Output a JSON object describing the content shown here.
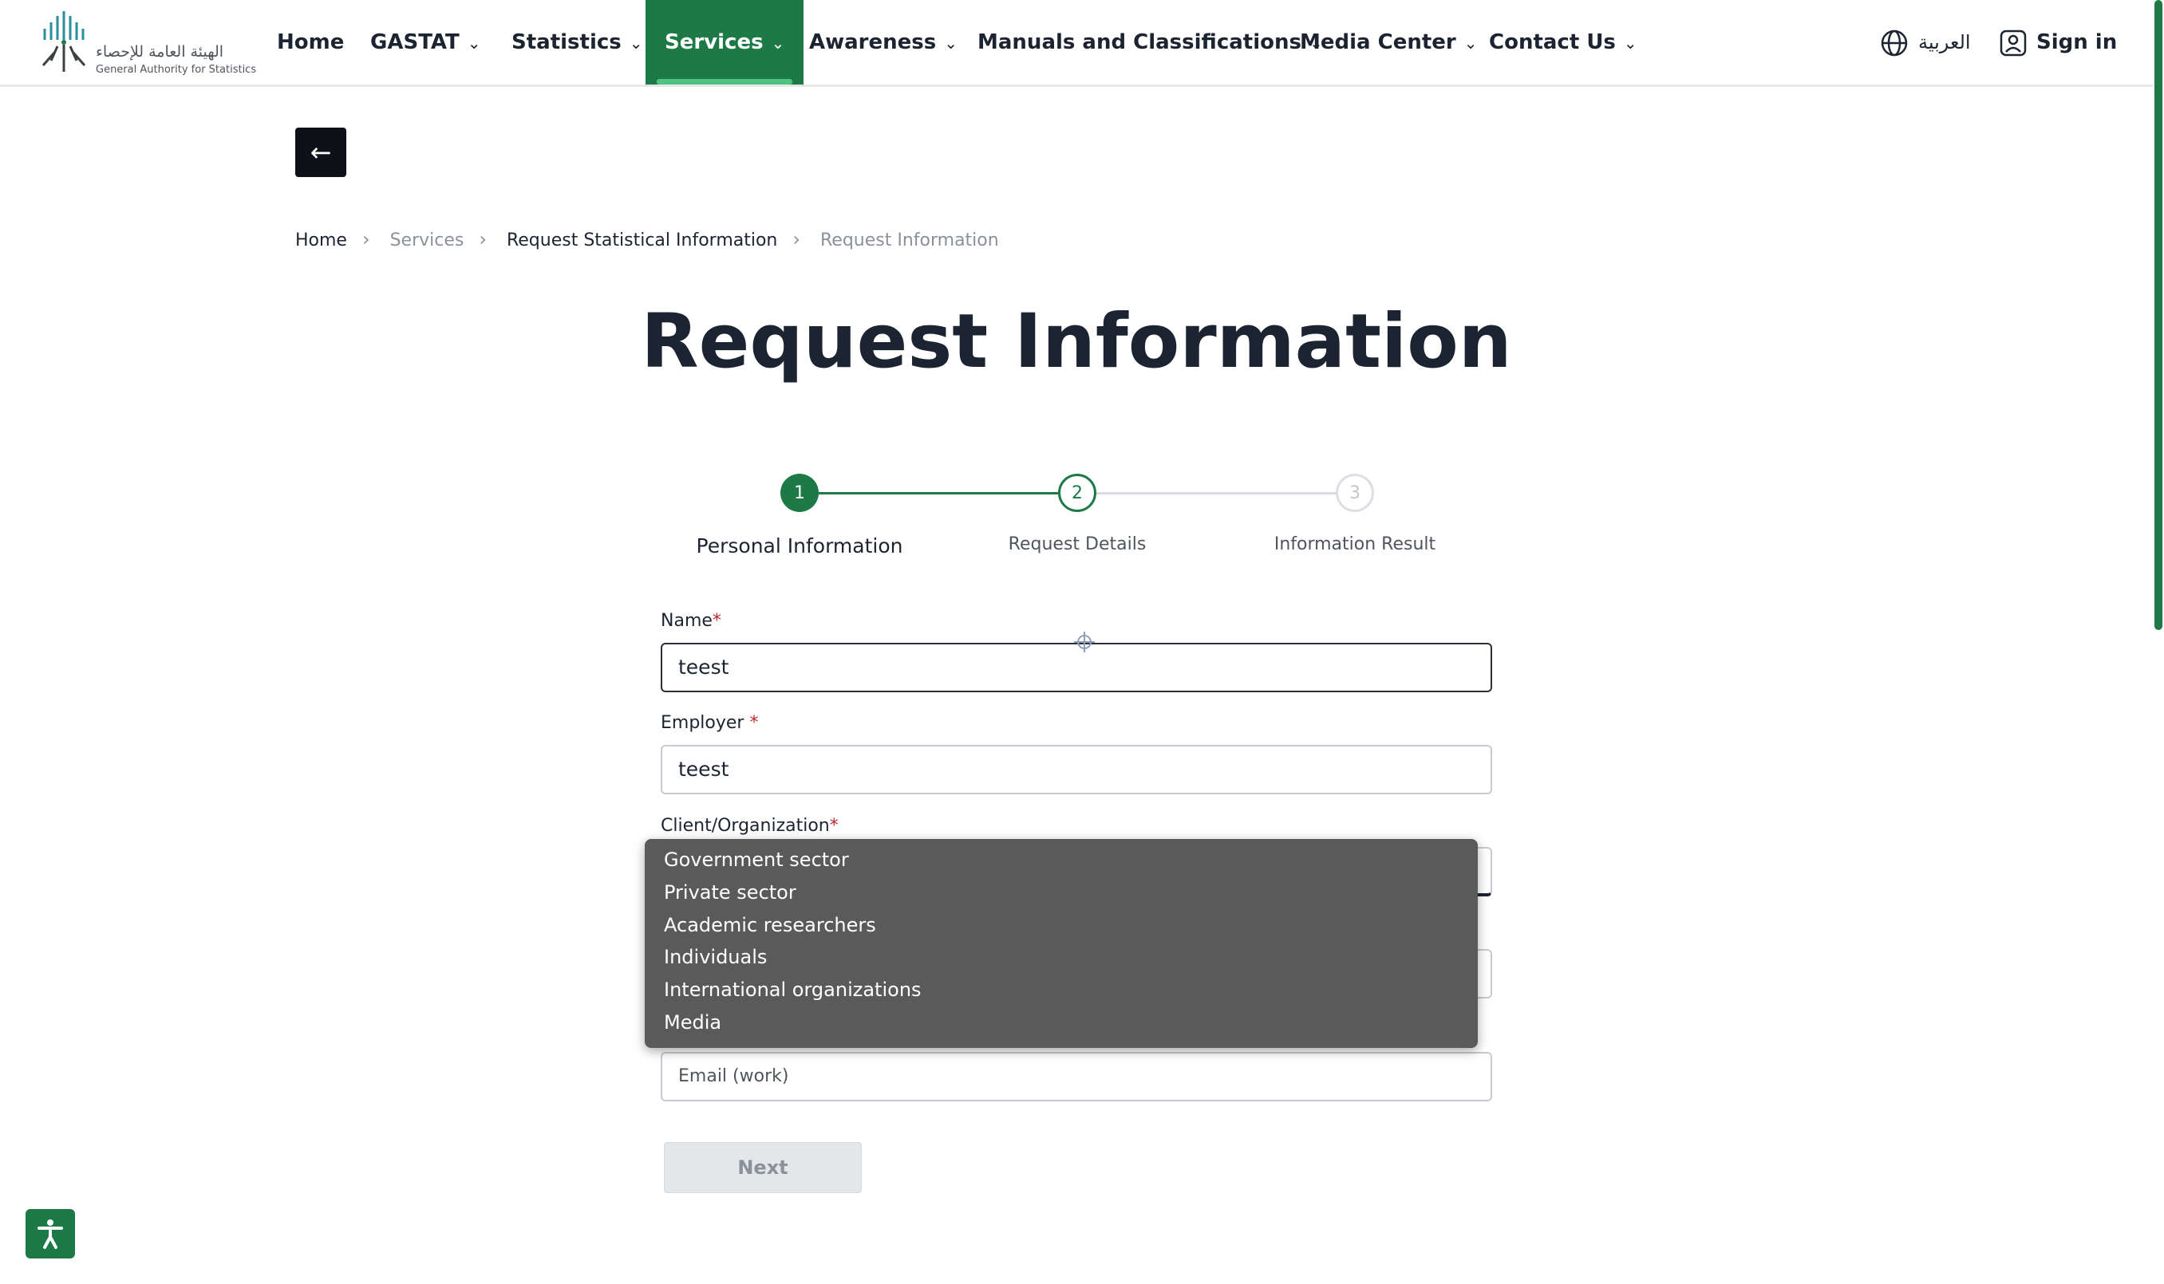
{
  "header": {
    "logo_arabic": "الهيئة العامة للإحصاء",
    "logo_english": "General Authority for Statistics",
    "nav": [
      {
        "label": "Home",
        "has_menu": false
      },
      {
        "label": "GASTAT",
        "has_menu": true
      },
      {
        "label": "Statistics",
        "has_menu": true
      },
      {
        "label": "Services",
        "has_menu": true,
        "active": true
      },
      {
        "label": "Awareness",
        "has_menu": true
      },
      {
        "label": "Manuals and Classifications",
        "has_menu": true
      },
      {
        "label": "Media Center",
        "has_menu": true
      },
      {
        "label": "Contact Us",
        "has_menu": true
      }
    ],
    "language_label": "العربية",
    "signin_label": "Sign in"
  },
  "breadcrumb": [
    "Home",
    "Services",
    "Request Statistical Information",
    "Request Information"
  ],
  "page_title": "Request Information",
  "stepper": {
    "steps": [
      {
        "number": "1",
        "label": "Personal Information",
        "state": "current"
      },
      {
        "number": "2",
        "label": "Request Details",
        "state": "upcoming"
      },
      {
        "number": "3",
        "label": "Information Result",
        "state": "disabled"
      }
    ]
  },
  "form": {
    "name_label": "Name",
    "name_value": "teest",
    "employer_label": "Employer ",
    "employer_value": "teest",
    "client_label": "Client/Organization",
    "required_mark": "*",
    "email_placeholder": "Email (work)",
    "next_label": "Next"
  },
  "dropdown": {
    "options": [
      "Government sector",
      "Private sector",
      "Academic researchers",
      "Individuals",
      "International organizations",
      "Media"
    ]
  },
  "colors": {
    "brand_green": "#1d7a47",
    "active_underline": "#4fc27f",
    "required": "#c0262d"
  }
}
